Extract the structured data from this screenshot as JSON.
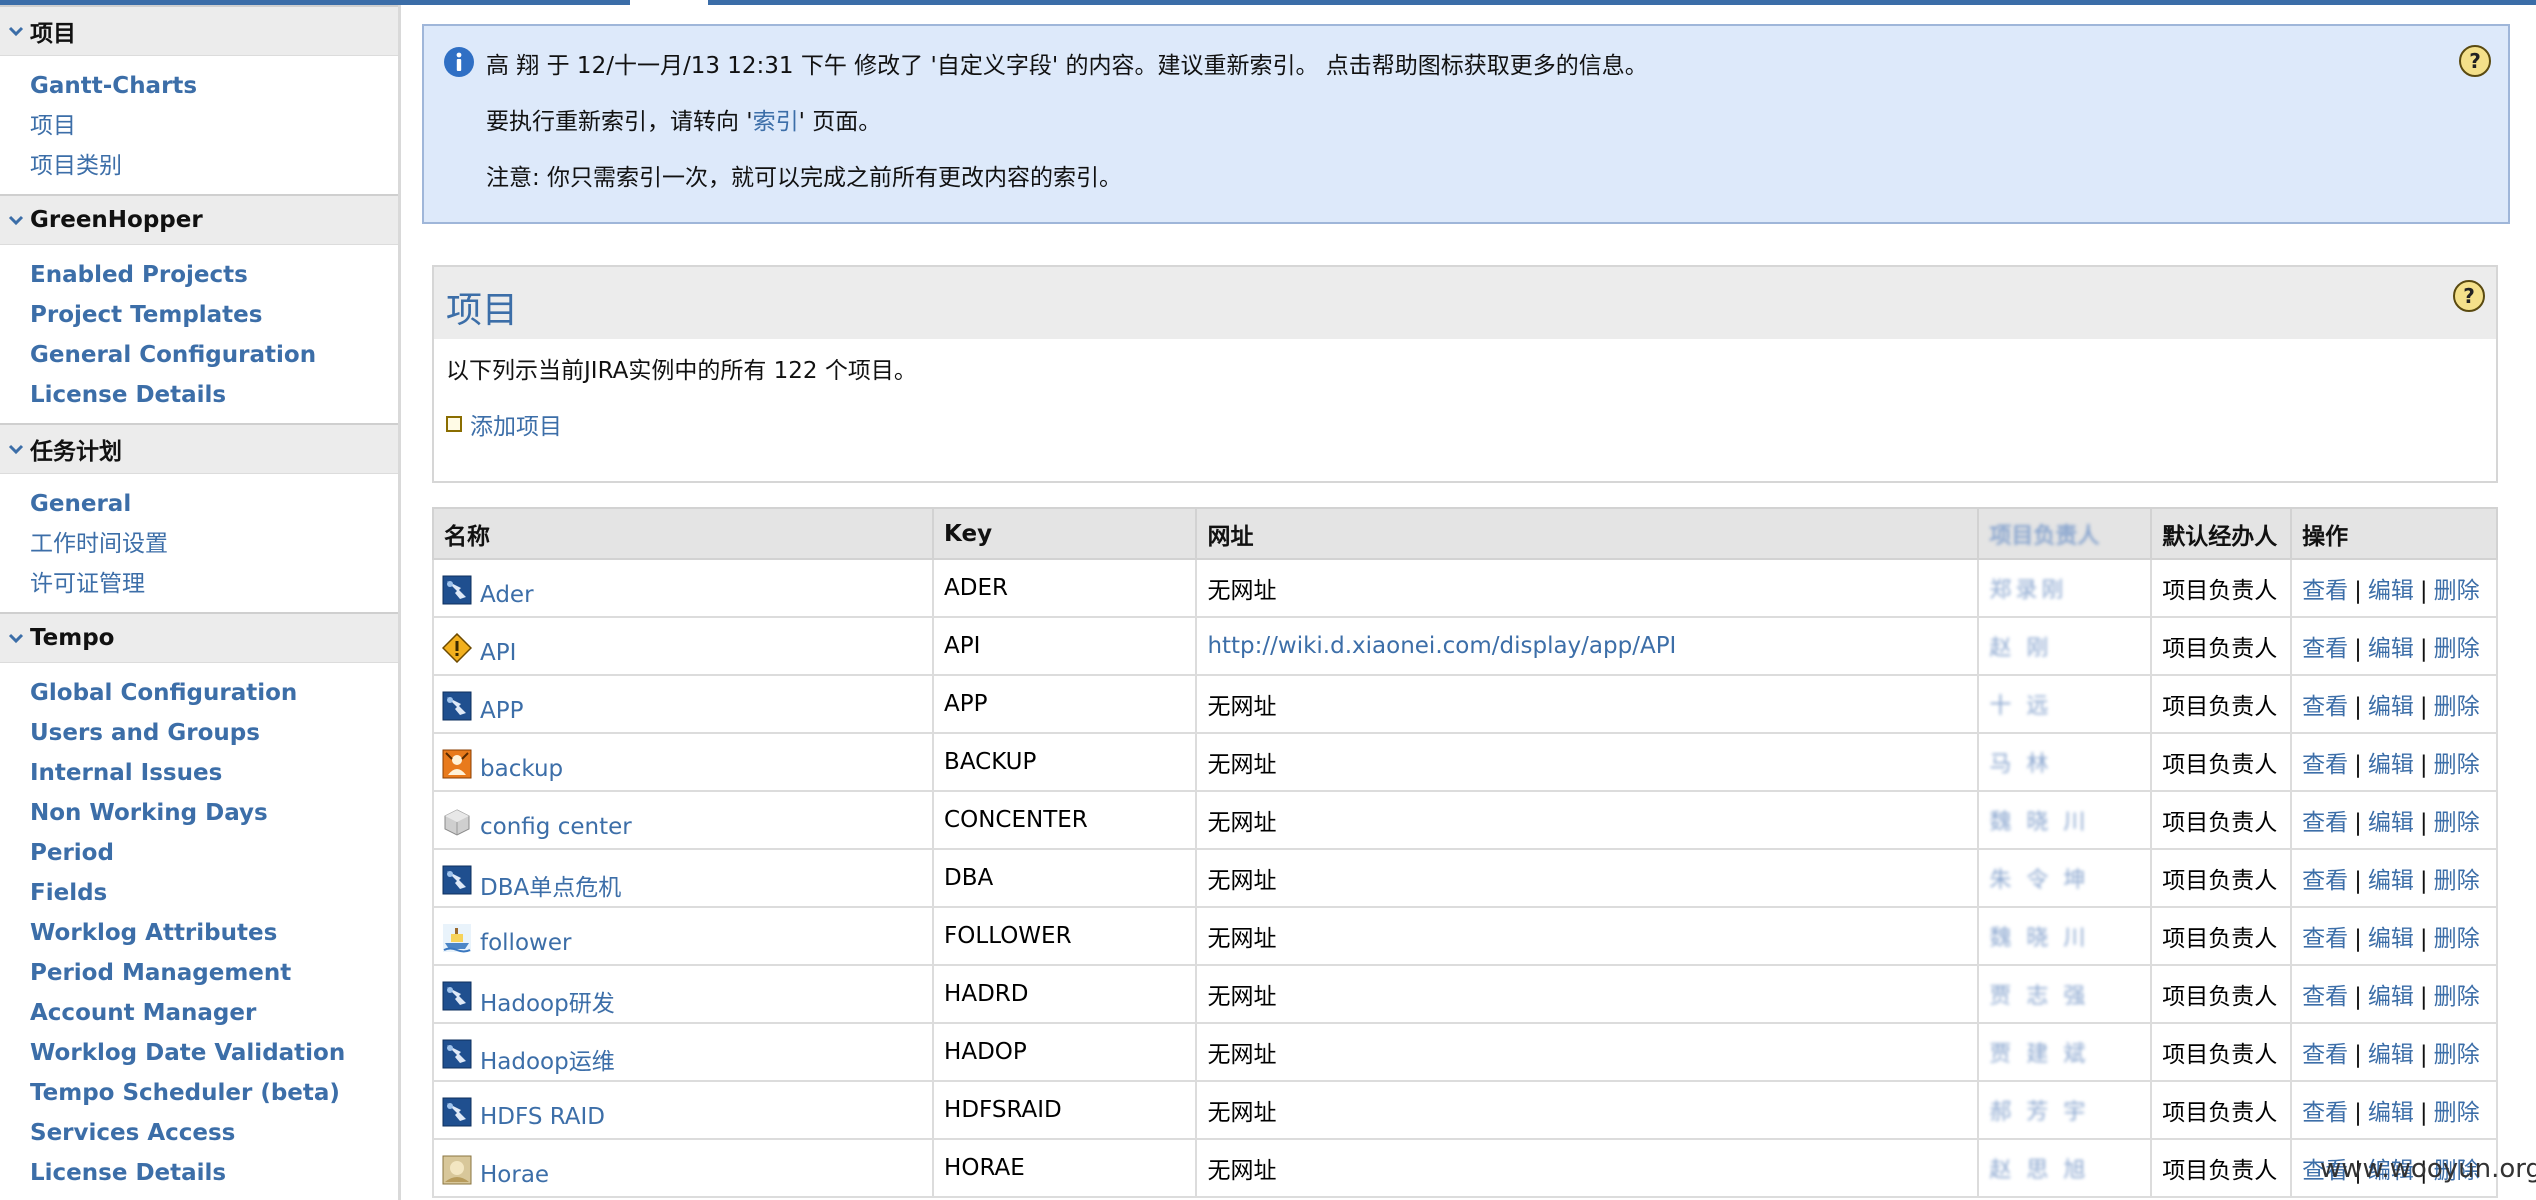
{
  "colors": {
    "accent": "#3c6ea8",
    "banner_bg": "#dde9fa",
    "sidebar_header_bg": "#ececec"
  },
  "sidebar": {
    "sections": [
      {
        "title": "项目",
        "items": [
          {
            "label": "Gantt-Charts",
            "bold": true
          },
          {
            "label": "项目",
            "bold": false
          },
          {
            "label": "项目类别",
            "bold": false
          }
        ]
      },
      {
        "title": "GreenHopper",
        "items": [
          {
            "label": "Enabled Projects",
            "bold": true
          },
          {
            "label": "Project Templates",
            "bold": true
          },
          {
            "label": "General Configuration",
            "bold": true
          },
          {
            "label": "License Details",
            "bold": true
          }
        ]
      },
      {
        "title": "任务计划",
        "items": [
          {
            "label": "General",
            "bold": true
          },
          {
            "label": "工作时间设置",
            "bold": false
          },
          {
            "label": "许可证管理",
            "bold": false
          }
        ]
      },
      {
        "title": "Tempo",
        "items": [
          {
            "label": "Global Configuration",
            "bold": true
          },
          {
            "label": "Users and Groups",
            "bold": true
          },
          {
            "label": "Internal Issues",
            "bold": true
          },
          {
            "label": "Non Working Days",
            "bold": true
          },
          {
            "label": "Period",
            "bold": true
          },
          {
            "label": "Fields",
            "bold": true
          },
          {
            "label": "Worklog Attributes",
            "bold": true
          },
          {
            "label": "Period Management",
            "bold": true
          },
          {
            "label": "Account Manager",
            "bold": true
          },
          {
            "label": "Worklog Date Validation",
            "bold": true
          },
          {
            "label": "Tempo Scheduler (beta)",
            "bold": true
          },
          {
            "label": "Services Access",
            "bold": true
          },
          {
            "label": "License Details",
            "bold": true
          }
        ]
      }
    ]
  },
  "banner": {
    "line1": "高 翔 于 12/十一月/13 12:31 下午 修改了 '自定义字段' 的内容。建议重新索引。 点击帮助图标获取更多的信息。",
    "line2_prefix": "要执行重新索引，请转向 '",
    "line2_link": "索引",
    "line2_suffix": "' 页面。",
    "line3": "注意: 你只需索引一次，就可以完成之前所有更改内容的索引。"
  },
  "panel": {
    "title": "项目",
    "description": "以下列示当前JIRA实例中的所有 122 个项目。",
    "add_project_label": "添加项目"
  },
  "table": {
    "headers": {
      "name": "名称",
      "key": "Key",
      "url": "网址",
      "lead": "项目负责人",
      "assignee": "默认经办人",
      "ops": "操作"
    },
    "ops": {
      "view": "查看",
      "edit": "编辑",
      "delete": "删除",
      "sep": "|"
    },
    "rows": [
      {
        "name": "Ader",
        "key": "ADER",
        "url": "无网址",
        "url_is_link": false,
        "lead": "郑录刚",
        "assignee": "项目负责人",
        "icon": "spike-icon"
      },
      {
        "name": "API",
        "key": "API",
        "url": "http://wiki.d.xiaonei.com/display/app/API",
        "url_is_link": true,
        "lead": "赵 刚",
        "assignee": "项目负责人",
        "icon": "warning-diamond-icon"
      },
      {
        "name": "APP",
        "key": "APP",
        "url": "无网址",
        "url_is_link": false,
        "lead": "十 远",
        "assignee": "项目负责人",
        "icon": "spike-icon"
      },
      {
        "name": "backup",
        "key": "BACKUP",
        "url": "无网址",
        "url_is_link": false,
        "lead": "马 林",
        "assignee": "项目负责人",
        "icon": "orange-avatar-icon"
      },
      {
        "name": "config center",
        "key": "CONCENTER",
        "url": "无网址",
        "url_is_link": false,
        "lead": "魏 晓 川",
        "assignee": "项目负责人",
        "icon": "gray-cube-icon"
      },
      {
        "name": "DBA单点危机",
        "key": "DBA",
        "url": "无网址",
        "url_is_link": false,
        "lead": "朱 令 坤",
        "assignee": "项目负责人",
        "icon": "spike-icon"
      },
      {
        "name": "follower",
        "key": "FOLLOWER",
        "url": "无网址",
        "url_is_link": false,
        "lead": "魏 晓 川",
        "assignee": "项目负责人",
        "icon": "ship-icon"
      },
      {
        "name": "Hadoop研发",
        "key": "HADRD",
        "url": "无网址",
        "url_is_link": false,
        "lead": "贾 志 强",
        "assignee": "项目负责人",
        "icon": "spike-icon"
      },
      {
        "name": "Hadoop运维",
        "key": "HADOP",
        "url": "无网址",
        "url_is_link": false,
        "lead": "贾 建 斌",
        "assignee": "项目负责人",
        "icon": "spike-icon"
      },
      {
        "name": "HDFS RAID",
        "key": "HDFSRAID",
        "url": "无网址",
        "url_is_link": false,
        "lead": "郝 芳 宇",
        "assignee": "项目负责人",
        "icon": "spike-icon"
      },
      {
        "name": "Horae",
        "key": "HORAE",
        "url": "无网址",
        "url_is_link": false,
        "lead": "赵 思 旭",
        "assignee": "项目负责人",
        "icon": "photo-icon"
      }
    ]
  },
  "watermark": "www.wooyun.org"
}
